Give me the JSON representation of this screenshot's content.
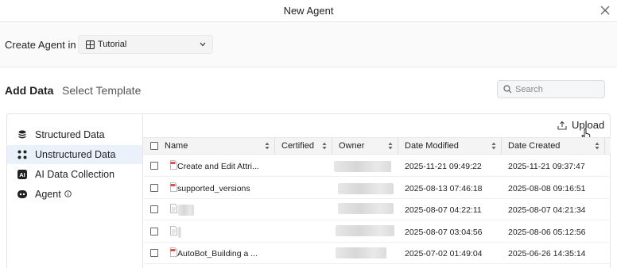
{
  "dialog": {
    "title": "New Agent"
  },
  "location": {
    "label": "Create Agent in",
    "selected": "Tutorial"
  },
  "tabs": {
    "add_data": "Add Data",
    "select_template": "Select Template"
  },
  "search": {
    "placeholder": "Search"
  },
  "sidebar": {
    "items": [
      {
        "label": "Structured Data",
        "icon": "database-icon",
        "active": false
      },
      {
        "label": "Unstructured Data",
        "icon": "dots-grid-icon",
        "active": true
      },
      {
        "label": "AI Data Collection",
        "icon": "ai-badge-icon",
        "active": false
      },
      {
        "label": "Agent",
        "icon": "agent-icon",
        "active": false
      }
    ]
  },
  "toolbar": {
    "upload_label": "Upload"
  },
  "table": {
    "columns": [
      "Name",
      "Certified",
      "Owner",
      "Date Modified",
      "Date Created"
    ],
    "rows": [
      {
        "name": "Create and Edit Attri...",
        "file_type": "pdf",
        "date_modified": "2025-11-21 09:49:22",
        "date_created": "2025-11-21 09:37:47"
      },
      {
        "name": "supported_versions",
        "file_type": "pdf",
        "date_modified": "2025-08-13 07:46:18",
        "date_created": "2025-08-08 09:16:51"
      },
      {
        "name": "",
        "file_type": "doc",
        "date_modified": "2025-08-07 04:22:11",
        "date_created": "2025-08-07 04:21:34"
      },
      {
        "name": "",
        "file_type": "doc",
        "date_modified": "2025-08-07 03:04:56",
        "date_created": "2025-08-06 05:12:56"
      },
      {
        "name": "AutoBot_Building a ...",
        "file_type": "pdf",
        "date_modified": "2025-07-02 01:49:04",
        "date_created": "2025-06-26 14:35:14"
      }
    ]
  },
  "colors": {
    "active_sidebar_bg": "#ebf1fb",
    "pdf_icon_red": "#d9534f"
  }
}
